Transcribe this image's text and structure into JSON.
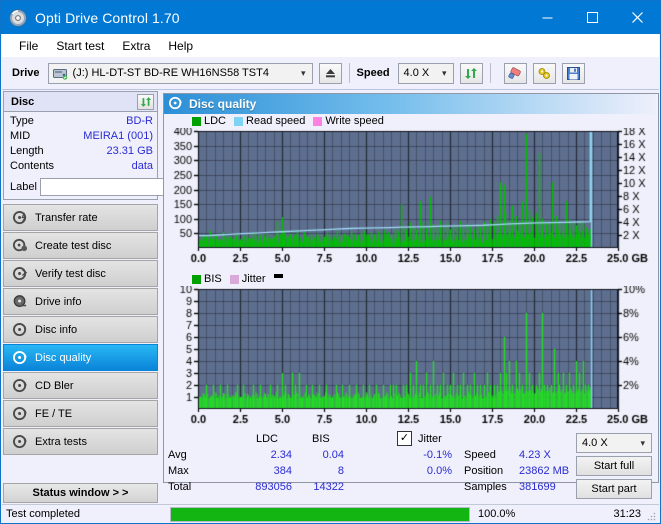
{
  "window": {
    "title": "Opti Drive Control 1.70",
    "icon": "disc-icon",
    "minimize": "–",
    "maximize": "▢",
    "close": "✕"
  },
  "menu": {
    "items": [
      {
        "label": "File",
        "name": "menu-file"
      },
      {
        "label": "Start test",
        "name": "menu-start-test"
      },
      {
        "label": "Extra",
        "name": "menu-extra"
      },
      {
        "label": "Help",
        "name": "menu-help"
      }
    ]
  },
  "toolbar": {
    "drive_label": "Drive",
    "drive_value": "(J:)  HL-DT-ST BD-RE  WH16NS58 TST4",
    "drive_icon": "drive-icon",
    "eject_icon": "eject-icon",
    "speed_label": "Speed",
    "speed_value": "4.0 X",
    "refresh_icon": "refresh-icon",
    "erase_icon": "eraser-icon",
    "tools_icon": "tools-icon",
    "save_icon": "save-icon",
    "combo_arrow": "chevron-down-icon"
  },
  "sidebar": {
    "disc_panel": {
      "title": "Disc",
      "refresh_icon": "refresh-icon",
      "rows": [
        {
          "label": "Type",
          "value": "BD-R"
        },
        {
          "label": "MID",
          "value": "MEIRA1 (001)"
        },
        {
          "label": "Length",
          "value": "23.31 GB"
        },
        {
          "label": "Contents",
          "value": "data"
        }
      ],
      "label_label": "Label",
      "label_value": "",
      "label_placeholder": "",
      "label_button_icon": "disc-icon"
    },
    "nav": [
      {
        "label": "Transfer rate",
        "name": "sidebar-item-transfer-rate",
        "icon": "disc-arrow-icon",
        "active": false
      },
      {
        "label": "Create test disc",
        "name": "sidebar-item-create-test-disc",
        "icon": "disc-burn-icon",
        "active": false
      },
      {
        "label": "Verify test disc",
        "name": "sidebar-item-verify-test-disc",
        "icon": "disc-check-icon",
        "active": false
      },
      {
        "label": "Drive info",
        "name": "sidebar-item-drive-info",
        "icon": "drive-info-icon",
        "active": false
      },
      {
        "label": "Disc info",
        "name": "sidebar-item-disc-info",
        "icon": "disc-info-icon",
        "active": false
      },
      {
        "label": "Disc quality",
        "name": "sidebar-item-disc-quality",
        "icon": "disc-quality-icon",
        "active": true
      },
      {
        "label": "CD Bler",
        "name": "sidebar-item-cd-bler",
        "icon": "disc-bler-icon",
        "active": false
      },
      {
        "label": "FE / TE",
        "name": "sidebar-item-fe-te",
        "icon": "disc-fete-icon",
        "active": false
      },
      {
        "label": "Extra tests",
        "name": "sidebar-item-extra-tests",
        "icon": "disc-extra-icon",
        "active": false
      }
    ],
    "status_window_button": "Status window > >"
  },
  "main": {
    "header_title": "Disc quality",
    "header_icon": "disc-quality-icon"
  },
  "stats": {
    "col_ldc": "LDC",
    "col_bis": "BIS",
    "row_avg": "Avg",
    "row_max": "Max",
    "row_total": "Total",
    "avg_ldc": "2.34",
    "avg_bis": "0.04",
    "max_ldc": "384",
    "max_bis": "8",
    "total_ldc": "893056",
    "total_bis": "14322",
    "jitter_label": "Jitter",
    "jitter_checked": "✓",
    "jitter_avg": "-0.1%",
    "jitter_max": "0.0%",
    "speed_label": "Speed",
    "speed_value": "4.23 X",
    "position_label": "Position",
    "position_value": "23862 MB",
    "samples_label": "Samples",
    "samples_value": "381699",
    "speed_select": "4.0 X",
    "speed_select_arrow": "chevron-down-icon",
    "start_full": "Start full",
    "start_part": "Start part"
  },
  "statusbar": {
    "text": "Test completed",
    "progress_pct": "100.0%",
    "progress_value": 100,
    "elapsed": "31:23"
  },
  "colors": {
    "accent": "#0078d4",
    "plot_bg": "#5e6e8e",
    "grid": "#3a4455",
    "ldc": "#00c000",
    "bis": "#22dd22",
    "read_speed": "#7fd4f5",
    "write_speed": "#ff80e0",
    "jitter": "#d9a9d9",
    "value_blue": "#2b2bd4",
    "progress_green": "#13b513"
  },
  "chart_data": [
    {
      "type": "bar",
      "name": "ldc-chart",
      "title": "",
      "xlabel": "GB",
      "ylabel": "",
      "xlim": [
        0,
        25
      ],
      "ylim": [
        0,
        400
      ],
      "y2lim": [
        0,
        18
      ],
      "y2label": "X",
      "grid": true,
      "legend": [
        {
          "label": "LDC",
          "color": "#00a000"
        },
        {
          "label": "Read speed",
          "color": "#7fd4f5"
        },
        {
          "label": "Write speed",
          "color": "#ff80e0"
        }
      ],
      "xticks": [
        "0.0",
        "2.5",
        "5.0",
        "7.5",
        "10.0",
        "12.5",
        "15.0",
        "17.5",
        "20.0",
        "22.5",
        "25.0"
      ],
      "yticks": [
        "50",
        "100",
        "150",
        "200",
        "250",
        "300",
        "350",
        "400"
      ],
      "y2ticks": [
        "2 X",
        "4 X",
        "6 X",
        "8 X",
        "10 X",
        "12 X",
        "14 X",
        "16 X",
        "18 X"
      ],
      "data_end_gb": 23.4,
      "series": [
        {
          "name": "LDC",
          "color": "#00c000",
          "kind": "spikes",
          "x": [
            0.1,
            0.3,
            0.5,
            0.7,
            0.9,
            1.1,
            1.3,
            1.5,
            1.7,
            1.9,
            2.1,
            2.3,
            2.5,
            2.7,
            2.9,
            3.1,
            3.3,
            3.5,
            3.7,
            3.9,
            4.1,
            4.3,
            4.5,
            4.7,
            4.9,
            5.0,
            5.1,
            5.3,
            5.5,
            5.7,
            5.9,
            6.1,
            6.3,
            6.5,
            6.7,
            6.9,
            7.1,
            7.3,
            7.5,
            7.7,
            7.9,
            8.1,
            8.3,
            8.5,
            8.7,
            8.9,
            9.1,
            9.3,
            9.5,
            9.7,
            9.9,
            10.1,
            10.3,
            10.5,
            10.7,
            10.9,
            11.1,
            11.3,
            11.5,
            11.7,
            11.9,
            12.1,
            12.3,
            12.4,
            12.6,
            12.8,
            13.0,
            13.2,
            13.4,
            13.6,
            13.8,
            14.0,
            14.2,
            14.4,
            14.6,
            14.8,
            15.0,
            15.2,
            15.4,
            15.6,
            15.8,
            16.0,
            16.2,
            16.4,
            16.6,
            16.8,
            17.0,
            17.2,
            17.4,
            17.6,
            17.8,
            18.0,
            18.2,
            18.3,
            18.5,
            18.7,
            18.9,
            19.1,
            19.3,
            19.5,
            19.7,
            19.9,
            20.1,
            20.3,
            20.5,
            20.7,
            20.9,
            21.1,
            21.3,
            21.5,
            21.7,
            21.9,
            22.1,
            22.3,
            22.5,
            22.7,
            22.9,
            23.1,
            23.3
          ],
          "y": [
            30,
            45,
            38,
            60,
            35,
            42,
            30,
            55,
            28,
            40,
            35,
            48,
            30,
            38,
            42,
            33,
            55,
            30,
            45,
            38,
            50,
            33,
            40,
            92,
            48,
            105,
            60,
            42,
            50,
            45,
            62,
            38,
            55,
            42,
            48,
            36,
            50,
            44,
            38,
            52,
            46,
            40,
            58,
            44,
            50,
            42,
            56,
            48,
            44,
            52,
            60,
            46,
            54,
            48,
            58,
            50,
            62,
            54,
            48,
            66,
            58,
            150,
            70,
            62,
            88,
            75,
            64,
            160,
            90,
            70,
            175,
            82,
            68,
            95,
            72,
            88,
            64,
            78,
            70,
            92,
            68,
            84,
            76,
            66,
            80,
            72,
            90,
            78,
            98,
            86,
            110,
            225,
            215,
            120,
            95,
            145,
            110,
            92,
            160,
            390,
            130,
            105,
            118,
            325,
            100,
            90,
            86,
            225,
            110,
            95,
            82,
            160,
            98,
            88,
            78,
            92,
            86,
            70,
            64
          ]
        },
        {
          "name": "Read speed",
          "color": "#9fdcf7",
          "kind": "line",
          "x": [
            0.0,
            0.6,
            1.2,
            1.8,
            2.6,
            3.4,
            4.2,
            5.0,
            5.8,
            6.6,
            7.4,
            8.2,
            9.0,
            9.8,
            10.6,
            11.4,
            12.2,
            13.0,
            13.8,
            14.6,
            15.4,
            16.2,
            17.0,
            17.8,
            18.6,
            19.4,
            20.2,
            21.0,
            21.8,
            22.6,
            23.35,
            23.35
          ],
          "y": [
            1.9,
            1.9,
            2.0,
            2.1,
            2.2,
            2.3,
            2.4,
            2.5,
            2.6,
            2.7,
            2.8,
            2.9,
            3.0,
            3.05,
            3.1,
            3.15,
            3.2,
            3.25,
            3.3,
            3.35,
            3.4,
            3.45,
            3.5,
            3.6,
            3.7,
            3.8,
            3.85,
            3.9,
            3.95,
            4.0,
            4.05,
            18.0
          ],
          "axis": "y2"
        },
        {
          "name": "Write speed",
          "color": "#ff80e0",
          "kind": "line",
          "x": [],
          "y": [],
          "axis": "y2"
        }
      ]
    },
    {
      "type": "bar",
      "name": "bis-chart",
      "title": "",
      "xlabel": "GB",
      "ylabel": "",
      "xlim": [
        0,
        25
      ],
      "ylim": [
        0,
        10
      ],
      "y2lim": [
        0,
        10
      ],
      "y2label": "%",
      "grid": true,
      "legend": [
        {
          "label": "BIS",
          "color": "#00a000"
        },
        {
          "label": "Jitter",
          "color": "#d9a9d9"
        }
      ],
      "xticks": [
        "0.0",
        "2.5",
        "5.0",
        "7.5",
        "10.0",
        "12.5",
        "15.0",
        "17.5",
        "20.0",
        "22.5",
        "25.0"
      ],
      "yticks": [
        "1",
        "2",
        "3",
        "4",
        "5",
        "6",
        "7",
        "8",
        "9",
        "10"
      ],
      "y2ticks": [
        "2%",
        "4%",
        "6%",
        "8%",
        "10%"
      ],
      "data_end_gb": 23.4,
      "series": [
        {
          "name": "BIS",
          "color": "#22dd22",
          "kind": "spikes",
          "x": [
            0.1,
            0.3,
            0.5,
            0.7,
            0.9,
            1.1,
            1.3,
            1.5,
            1.7,
            1.9,
            2.1,
            2.3,
            2.5,
            2.7,
            2.9,
            3.1,
            3.3,
            3.5,
            3.7,
            3.9,
            4.1,
            4.3,
            4.5,
            4.7,
            4.9,
            5.0,
            5.2,
            5.4,
            5.6,
            5.8,
            6.0,
            6.2,
            6.4,
            6.6,
            6.8,
            7.0,
            7.2,
            7.4,
            7.6,
            7.8,
            8.0,
            8.2,
            8.4,
            8.6,
            8.8,
            9.0,
            9.2,
            9.4,
            9.6,
            9.8,
            10.0,
            10.2,
            10.4,
            10.6,
            10.8,
            11.0,
            11.2,
            11.4,
            11.6,
            11.8,
            12.0,
            12.2,
            12.4,
            12.6,
            12.8,
            13.0,
            13.2,
            13.4,
            13.6,
            13.8,
            14.0,
            14.2,
            14.4,
            14.6,
            14.8,
            15.0,
            15.2,
            15.4,
            15.6,
            15.8,
            16.0,
            16.2,
            16.4,
            16.6,
            16.8,
            17.0,
            17.2,
            17.4,
            17.6,
            17.8,
            18.0,
            18.2,
            18.35,
            18.5,
            18.7,
            18.9,
            19.1,
            19.3,
            19.5,
            19.7,
            19.9,
            20.1,
            20.3,
            20.45,
            20.6,
            20.8,
            21.0,
            21.2,
            21.4,
            21.5,
            21.7,
            21.9,
            22.1,
            22.3,
            22.5,
            22.7,
            22.9,
            23.05,
            23.2,
            23.3
          ],
          "y": [
            1,
            1,
            2,
            1,
            2,
            1,
            2,
            1,
            2,
            1,
            1,
            2,
            1,
            2,
            1,
            1,
            2,
            1,
            2,
            1,
            1,
            2,
            1,
            2,
            1,
            3,
            2,
            1,
            3,
            2,
            3,
            1,
            2,
            1,
            2,
            1,
            2,
            1,
            2,
            1,
            1,
            2,
            1,
            2,
            1,
            2,
            1,
            2,
            1,
            2,
            1,
            2,
            1,
            2,
            1,
            2,
            1,
            2,
            2,
            2,
            1,
            2,
            2,
            3,
            2,
            4,
            2,
            2,
            3,
            2,
            4,
            2,
            2,
            3,
            2,
            2,
            3,
            2,
            2,
            3,
            2,
            2,
            3,
            2,
            2,
            2,
            3,
            2,
            2,
            2,
            3,
            6,
            3,
            4,
            2,
            4,
            3,
            2,
            8,
            3,
            2,
            2,
            3,
            8,
            2,
            2,
            2,
            5,
            3,
            2,
            3,
            2,
            3,
            2,
            4,
            3,
            4,
            2,
            2,
            1
          ]
        },
        {
          "name": "Jitter",
          "color": "#d9a9d9",
          "kind": "line",
          "x": [],
          "y": [],
          "axis": "y2"
        }
      ]
    }
  ]
}
